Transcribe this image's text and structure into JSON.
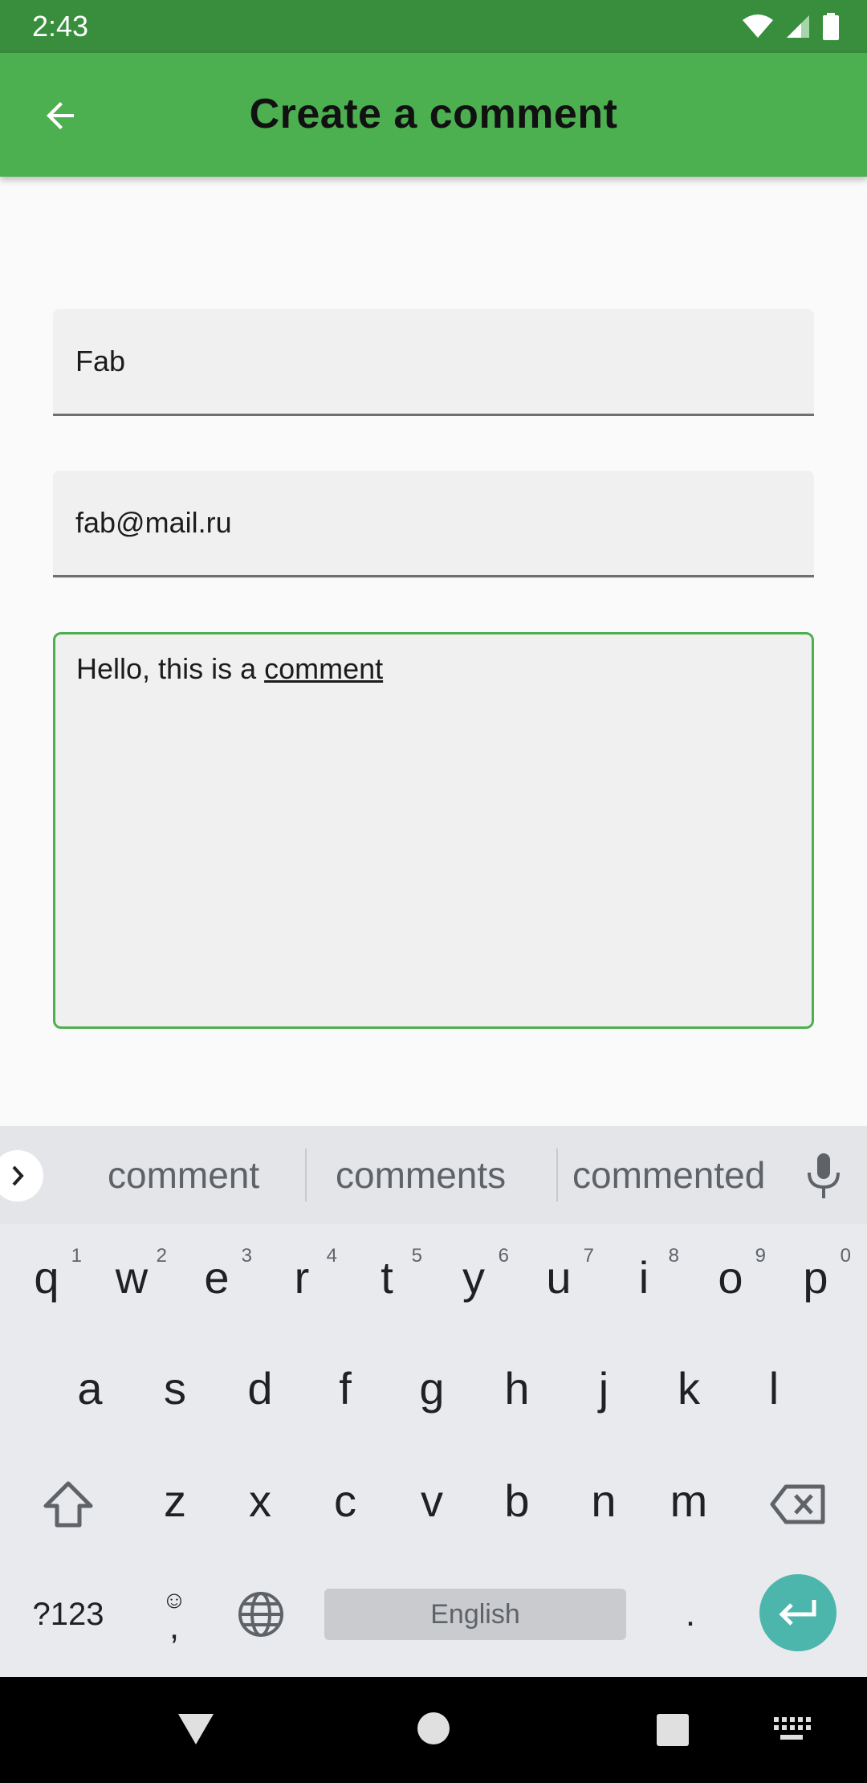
{
  "status_bar": {
    "time": "2:43"
  },
  "app_bar": {
    "title": "Create a comment"
  },
  "form": {
    "name_value": "Fab",
    "email_value": "fab@mail.ru",
    "comment_prefix": "Hello, this is a ",
    "comment_word": "comment"
  },
  "keyboard": {
    "suggestions": [
      "comment",
      "comments",
      "commented"
    ],
    "row1": [
      {
        "key": "q",
        "hint": "1"
      },
      {
        "key": "w",
        "hint": "2"
      },
      {
        "key": "e",
        "hint": "3"
      },
      {
        "key": "r",
        "hint": "4"
      },
      {
        "key": "t",
        "hint": "5"
      },
      {
        "key": "y",
        "hint": "6"
      },
      {
        "key": "u",
        "hint": "7"
      },
      {
        "key": "i",
        "hint": "8"
      },
      {
        "key": "o",
        "hint": "9"
      },
      {
        "key": "p",
        "hint": "0"
      }
    ],
    "row2": [
      "a",
      "s",
      "d",
      "f",
      "g",
      "h",
      "j",
      "k",
      "l"
    ],
    "row3": [
      "z",
      "x",
      "c",
      "v",
      "b",
      "n",
      "m"
    ],
    "symbols_label": "?123",
    "emoji_glyph": "☺",
    "comma_label": ",",
    "space_label": "English",
    "period_label": "."
  },
  "colors": {
    "status_bar": "#388e3c",
    "app_bar": "#4caf50",
    "focus_border": "#4caf50",
    "enter_key": "#4db6ac"
  }
}
